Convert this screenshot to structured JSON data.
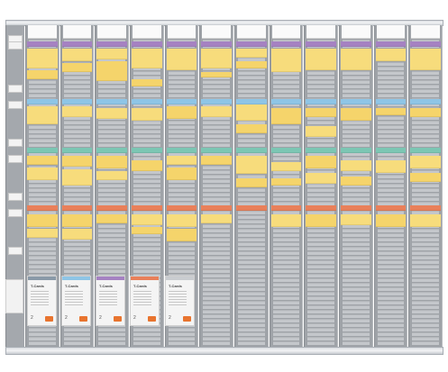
{
  "board": {
    "column_count": 12,
    "row_band_colors": {
      "purple": "#a582c2",
      "blue": "#8ec5e6",
      "teal": "#7cc6b3",
      "orange": "#e9805a",
      "yellow": "#f7dc7c"
    }
  },
  "card_packs": [
    {
      "title": "T-Cards",
      "number": "2",
      "band_color": "#8a9aa8"
    },
    {
      "title": "T-Cards",
      "number": "2",
      "band_color": "#8ec5e6"
    },
    {
      "title": "T-Cards",
      "number": "2",
      "band_color": "#a582c2"
    },
    {
      "title": "T-Cards",
      "number": "2",
      "band_color": "#e9805a"
    },
    {
      "title": "T-Cards",
      "number": "2",
      "band_color": "#c9ccd0"
    }
  ]
}
